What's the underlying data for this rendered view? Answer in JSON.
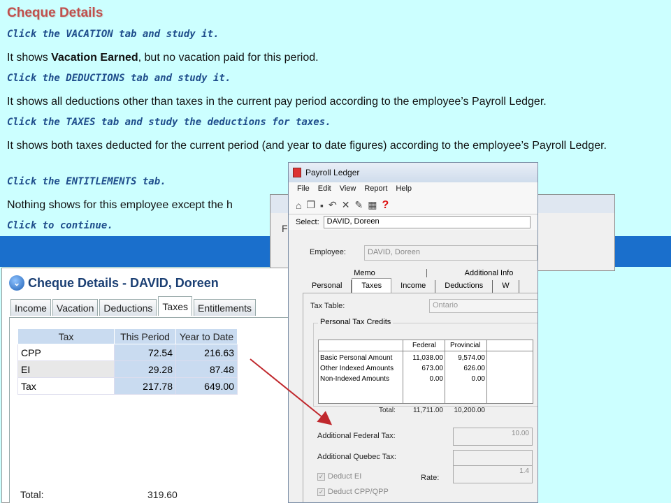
{
  "slide": {
    "title": "Cheque Details",
    "instructions": [
      "Click the VACATION tab and study it.",
      "Click the DEDUCTIONS tab and study it.",
      "Click the TAXES tab and study the deductions for taxes.",
      "Click the ENTITLEMENTS tab.",
      "Click to continue."
    ],
    "para1_prefix": "It shows ",
    "para1_bold": "Vacation Earned",
    "para1_suffix": ", but no vacation paid for this period.",
    "para2": "It shows all deductions other than taxes in the current pay period  according to the employee’s Payroll Ledger.",
    "para3": "It shows both taxes deducted for the current period (and year to date figures) according to the employee’s Payroll Ledger.",
    "para4": "Nothing shows for this employee except the h"
  },
  "behind_window": {
    "menu_letter": "F"
  },
  "cheque_window": {
    "title": "Cheque Details - DAVID, Doreen",
    "tabs": [
      "Income",
      "Vacation",
      "Deductions",
      "Taxes",
      "Entitlements"
    ],
    "active_tab": "Taxes",
    "columns": [
      "Tax",
      "This Period",
      "Year to Date"
    ],
    "rows": [
      {
        "tax": "CPP",
        "this_period": "72.54",
        "ytd": "216.63"
      },
      {
        "tax": "EI",
        "this_period": "29.28",
        "ytd": "87.48"
      },
      {
        "tax": "Tax",
        "this_period": "217.78",
        "ytd": "649.00"
      }
    ],
    "total_label": "Total:",
    "total_value": "319.60"
  },
  "ledger_window": {
    "title": "Payroll Ledger",
    "menu": [
      "File",
      "Edit",
      "View",
      "Report",
      "Help"
    ],
    "select_label": "Select:",
    "select_value": "DAVID, Doreen",
    "employee_label": "Employee:",
    "employee_value": "DAVID, Doreen",
    "tabs_row1": [
      "Memo",
      "Additional Info"
    ],
    "tabs_row2": [
      "Personal",
      "Taxes",
      "Income",
      "Deductions",
      "W"
    ],
    "active_tab": "Taxes",
    "tax_table_label": "Tax Table:",
    "tax_table_value": "Ontario",
    "credits_group_label": "Personal Tax Credits",
    "credits_columns": [
      "Federal",
      "Provincial"
    ],
    "credits_rows": [
      {
        "label": "Basic Personal Amount",
        "federal": "11,038.00",
        "provincial": "9,574.00"
      },
      {
        "label": "Other Indexed Amounts",
        "federal": "673.00",
        "provincial": "626.00"
      },
      {
        "label": "Non-Indexed Amounts",
        "federal": "0.00",
        "provincial": "0.00"
      }
    ],
    "credits_total_label": "Total:",
    "credits_total_federal": "11,711.00",
    "credits_total_provincial": "10,200.00",
    "additional_federal_label": "Additional Federal Tax:",
    "additional_federal_value": "10.00",
    "additional_quebec_label": "Additional Quebec Tax:",
    "deduct_ei_label": "Deduct EI",
    "deduct_cpp_label": "Deduct CPP/QPP",
    "rate_label": "Rate:",
    "rate_value": "1.4"
  },
  "colors": {
    "background": "#ccffff",
    "band": "#1a6fcc",
    "title": "#c0504d",
    "instruction": "#1f4e8c",
    "arrow": "#c0282d"
  }
}
